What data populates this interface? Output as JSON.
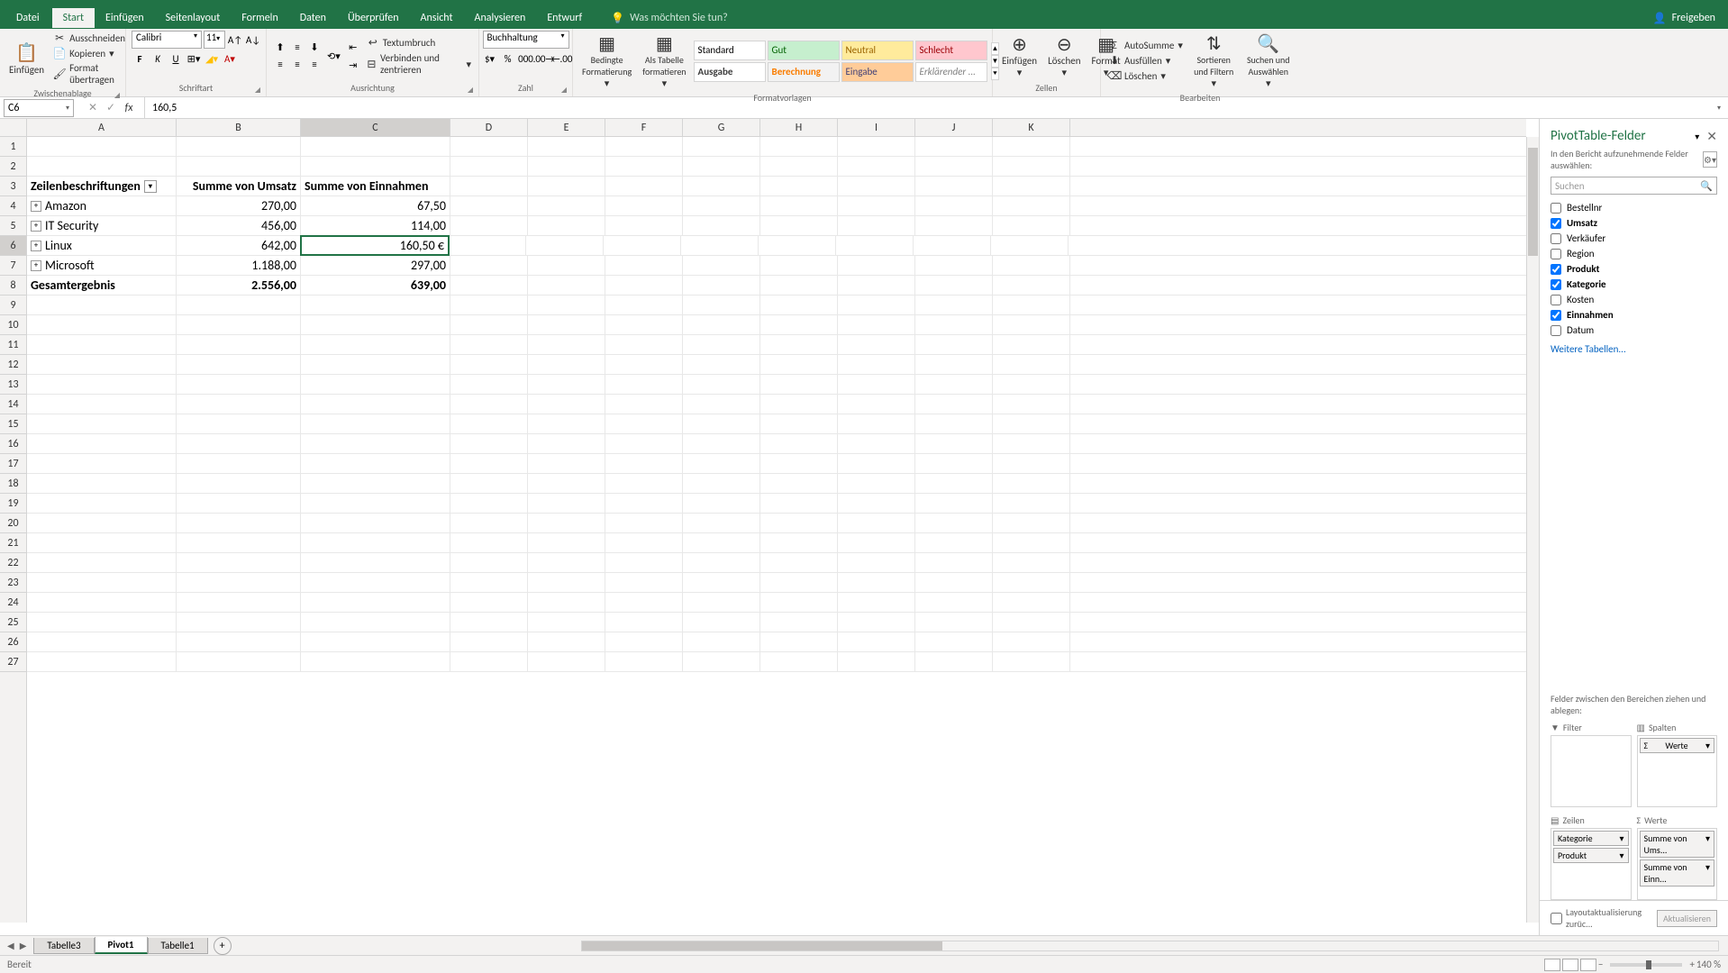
{
  "ribbon": {
    "tabs": [
      "Datei",
      "Start",
      "Einfügen",
      "Seitenlayout",
      "Formeln",
      "Daten",
      "Überprüfen",
      "Ansicht",
      "Analysieren",
      "Entwurf"
    ],
    "activeTab": "Start",
    "tellMe": "Was möchten Sie tun?",
    "share": "Freigeben"
  },
  "clipboard": {
    "paste": "Einfügen",
    "cut": "Ausschneiden",
    "copy": "Kopieren",
    "formatPainter": "Format übertragen",
    "group": "Zwischenablage"
  },
  "font": {
    "name": "Calibri",
    "size": "11",
    "group": "Schriftart"
  },
  "alignment": {
    "wrap": "Textumbruch",
    "merge": "Verbinden und zentrieren",
    "group": "Ausrichtung"
  },
  "number": {
    "format": "Buchhaltung",
    "group": "Zahl"
  },
  "styles": {
    "conditional": "Bedingte Formatierung",
    "asTable": "Als Tabelle formatieren",
    "standard": "Standard",
    "gut": "Gut",
    "neutral": "Neutral",
    "schlecht": "Schlecht",
    "ausgabe": "Ausgabe",
    "berechnung": "Berechnung",
    "eingabe": "Eingabe",
    "erkl": "Erklärender ...",
    "group": "Formatvorlagen"
  },
  "cells": {
    "insert": "Einfügen",
    "delete": "Löschen",
    "format": "Format",
    "group": "Zellen"
  },
  "editing": {
    "autosum": "AutoSumme",
    "fill": "Ausfüllen",
    "clear": "Löschen",
    "sortFilter": "Sortieren und Filtern",
    "findSelect": "Suchen und Auswählen",
    "group": "Bearbeiten"
  },
  "formulaBar": {
    "nameBox": "C6",
    "formula": "160,5"
  },
  "columns": [
    "A",
    "B",
    "C",
    "D",
    "E",
    "F",
    "G",
    "H",
    "I",
    "J",
    "K"
  ],
  "pivotData": {
    "headers": [
      "Zeilenbeschriftungen",
      "Summe von Umsatz",
      "Summe von Einnahmen"
    ],
    "rows": [
      {
        "label": "Amazon",
        "umsatz": "270,00",
        "einnahmen": "67,50"
      },
      {
        "label": "IT Security",
        "umsatz": "456,00",
        "einnahmen": "114,00"
      },
      {
        "label": "Linux",
        "umsatz": "642,00",
        "einnahmen": "160,50 €"
      },
      {
        "label": "Microsoft",
        "umsatz": "1.188,00",
        "einnahmen": "297,00"
      }
    ],
    "total": {
      "label": "Gesamtergebnis",
      "umsatz": "2.556,00",
      "einnahmen": "639,00"
    }
  },
  "pivotPane": {
    "title": "PivotTable-Felder",
    "subtitle": "In den Bericht aufzunehmende Felder auswählen:",
    "search": "Suchen",
    "fields": [
      {
        "name": "Bestellnr",
        "checked": false
      },
      {
        "name": "Umsatz",
        "checked": true
      },
      {
        "name": "Verkäufer",
        "checked": false
      },
      {
        "name": "Region",
        "checked": false
      },
      {
        "name": "Produkt",
        "checked": true
      },
      {
        "name": "Kategorie",
        "checked": true
      },
      {
        "name": "Kosten",
        "checked": false
      },
      {
        "name": "Einnahmen",
        "checked": true
      },
      {
        "name": "Datum",
        "checked": false
      }
    ],
    "moreTables": "Weitere Tabellen...",
    "dragHint": "Felder zwischen den Bereichen ziehen und ablegen:",
    "zones": {
      "filter": "Filter",
      "columns": "Spalten",
      "rows": "Zeilen",
      "values": "Werte"
    },
    "columnsItems": [
      "Werte"
    ],
    "rowsItems": [
      "Kategorie",
      "Produkt"
    ],
    "valuesItems": [
      "Summe von Ums...",
      "Summe von Einn..."
    ],
    "defer": "Layoutaktualisierung zurüc...",
    "update": "Aktualisieren"
  },
  "sheets": {
    "tabs": [
      "Tabelle3",
      "Pivot1",
      "Tabelle1"
    ],
    "active": "Pivot1"
  },
  "status": {
    "ready": "Bereit",
    "zoom": "140 %"
  }
}
